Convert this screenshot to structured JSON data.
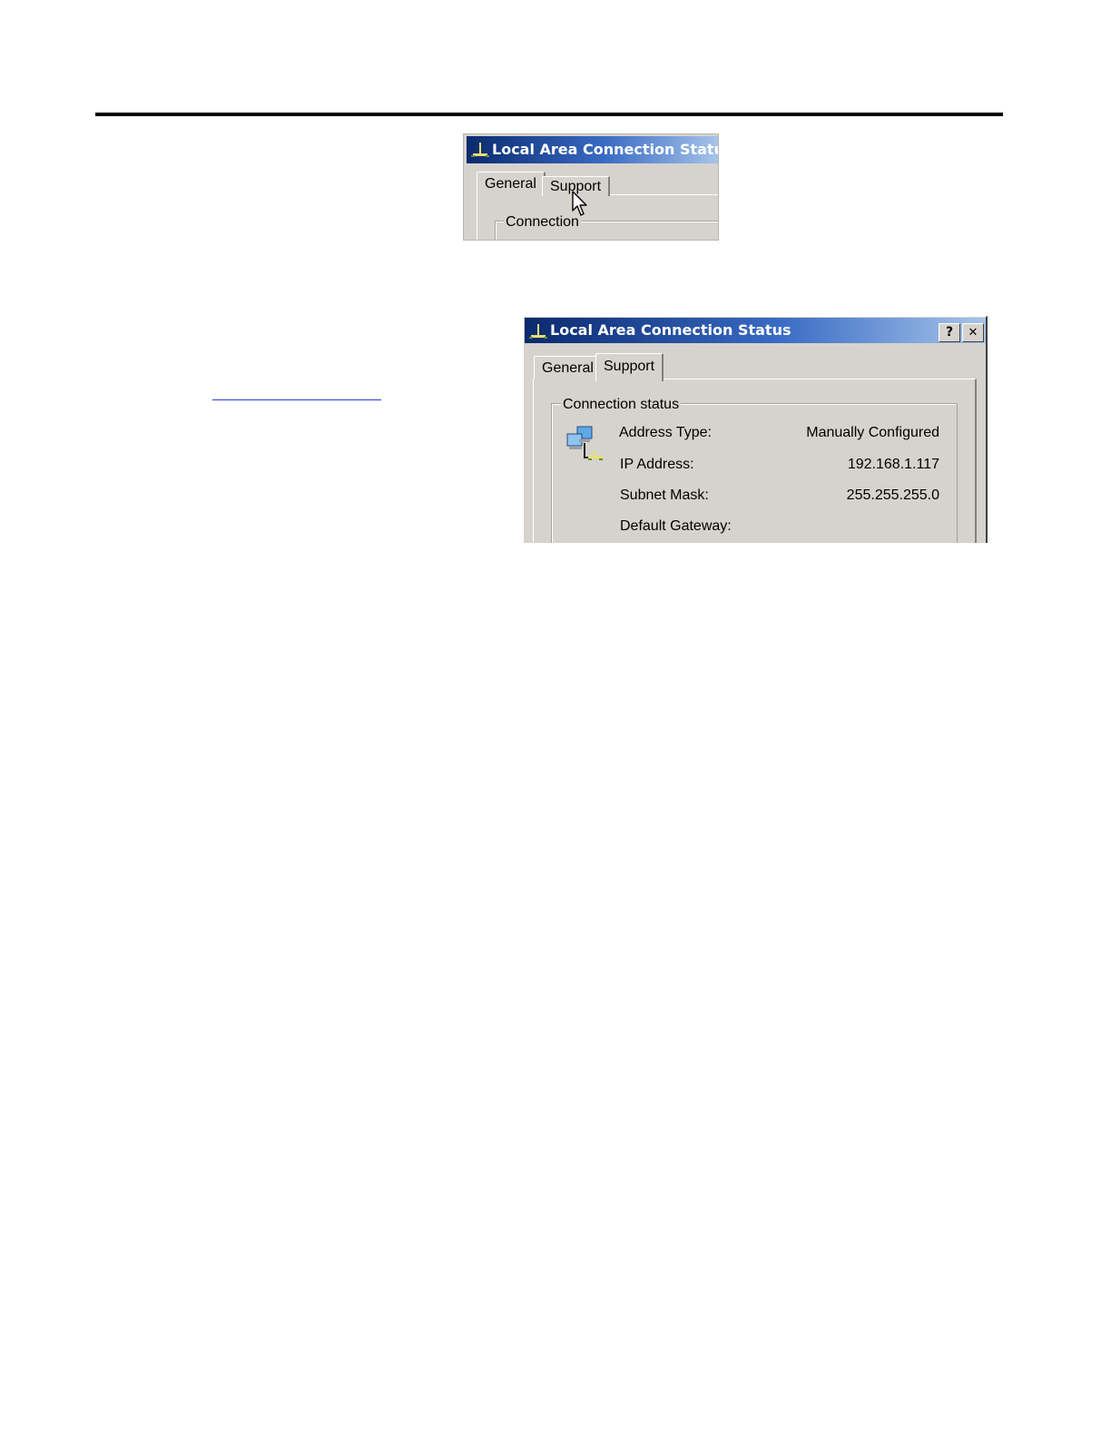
{
  "top_dialog": {
    "title": "Local Area Connection Status",
    "tabs": [
      "General",
      "Support"
    ],
    "group_label": "Connection"
  },
  "main_dialog": {
    "title": "Local Area Connection Status",
    "help_button": "?",
    "close_button": "✕",
    "tabs": [
      "General",
      "Support"
    ],
    "group_label": "Connection status",
    "rows": [
      {
        "label": "Address Type:",
        "value": "Manually Configured"
      },
      {
        "label": "IP Address:",
        "value": "192.168.1.117"
      },
      {
        "label": "Subnet Mask:",
        "value": "255.255.255.0"
      },
      {
        "label": "Default Gateway:",
        "value": ""
      }
    ]
  }
}
